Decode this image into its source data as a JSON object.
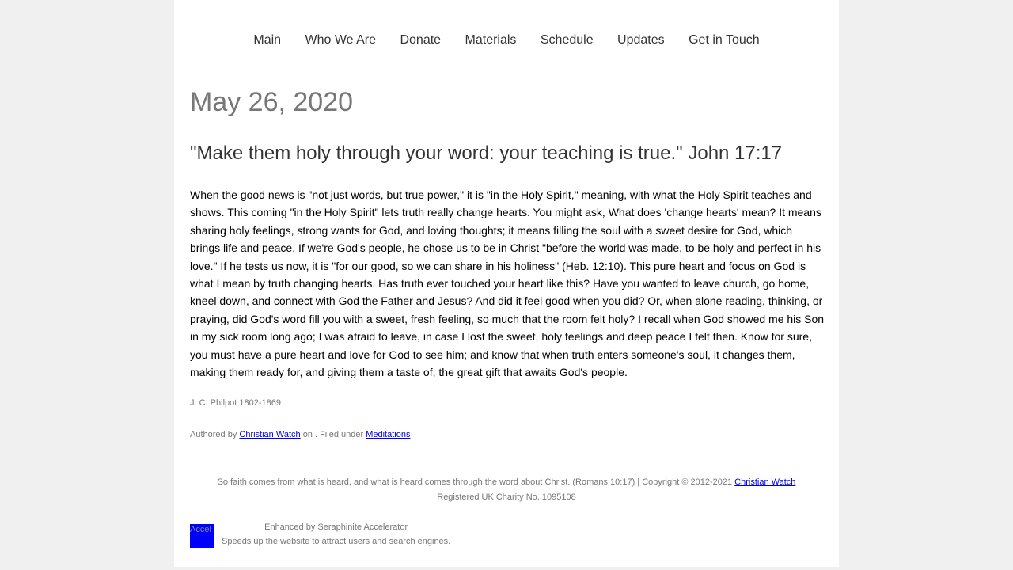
{
  "nav": {
    "items": [
      "Main",
      "Who We Are",
      "Donate",
      "Materials",
      "Schedule",
      "Updates",
      "Get in Touch"
    ]
  },
  "post": {
    "date": "May 26, 2020",
    "verse": "\"Make them holy through your word: your teaching is true.\" John 17:17",
    "body": "When the good news is \"not just words, but true power,\" it is \"in the Holy Spirit,\" meaning, with what the Holy Spirit teaches and shows. This coming \"in the Holy Spirit\" lets truth really change hearts. You might ask, What does 'change hearts' mean? It means sharing holy feelings, strong wants for God, and loving thoughts; it means filling the soul with a sweet desire for God, which brings life and peace. If we're God's people, he chose us to be in Christ \"before the world was made, to be holy and perfect in his love.\" If he tests us now, it is \"for our good, so we can share in his holiness\" (Heb. 12:10). This pure heart and focus on God is what I mean by truth changing hearts. Has truth ever touched your heart like this? Have you wanted to leave church, go home, kneel down, and connect with God the Father and Jesus? And did it feel good when you did? Or, when alone reading, thinking, or praying, did God's word fill you with a sweet, fresh feeling, so much that the room felt holy? I recall when God showed me his Son in my sick room long ago; I was afraid to leave, in case I lost the sweet, holy feelings and deep peace I felt then. Know for sure, you must have a pure heart and love for God to see him; and know that when truth enters someone's soul, it changes them, making them ready for, and giving them a taste of, the great gift that awaits God's people.",
    "attribution": "J. C. Philpot 1802-1869",
    "meta_authored": "Authored by",
    "meta_author": "Christian Watch",
    "meta_filed": "on . Filed under",
    "meta_category": "Meditations"
  },
  "footer": {
    "text": "So faith comes from what is heard, and what is heard comes through the word about Christ. (Romans 10:17) | Copyright © 2012-2021",
    "link": "Christian Watch",
    "charity": "Registered UK Charity No. 1095108"
  },
  "accelerator": {
    "img_alt": "Accel",
    "line1": "Enhanced by Seraphinite Accelerator",
    "line2": "Speeds up the website to attract users and search engines."
  },
  "colors": {
    "background": "#f0f0f0",
    "page": "#ffffff",
    "link": "#0000ee",
    "muted": "#777777"
  }
}
